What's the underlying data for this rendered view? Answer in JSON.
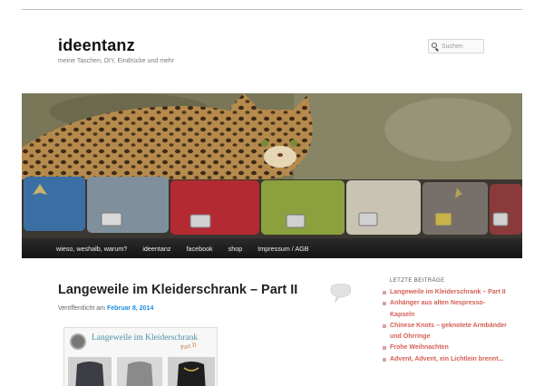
{
  "site": {
    "title": "ideentanz",
    "description": "meine Taschen, DIY, Eindrücke und mehr"
  },
  "search": {
    "placeholder": "Suchen",
    "icon": "search-icon"
  },
  "nav": {
    "items": [
      {
        "label": "wieso, weshalb, warum?"
      },
      {
        "label": "ideentanz"
      },
      {
        "label": "facebook"
      },
      {
        "label": "shop"
      },
      {
        "label": "Impressum / AGB"
      }
    ]
  },
  "post": {
    "title": "Langeweile im Kleiderschrank – Part II",
    "published_prefix": "Veröffentlicht am",
    "date": "Februar 8, 2014",
    "image_heading": "Langeweile im Kleiderschrank",
    "image_part": "Part II"
  },
  "sidebar": {
    "widget_title": "LETZTE BEITRÄGE",
    "recent_posts": [
      {
        "label": "Langeweile im Kleiderschrank – Part II"
      },
      {
        "label": "Anhänger aus alten Nespresso-Kapseln"
      },
      {
        "label": "Chinese Knots – geknotete Armbänder und Ohrringe"
      },
      {
        "label": "Frohe Weihnachten"
      },
      {
        "label": "Advent, Advent, ein Lichtlein brennt..."
      }
    ]
  },
  "colors": {
    "link": "#d45f55",
    "date_link": "#1b8be0",
    "navbar": "#1e1e1e"
  }
}
